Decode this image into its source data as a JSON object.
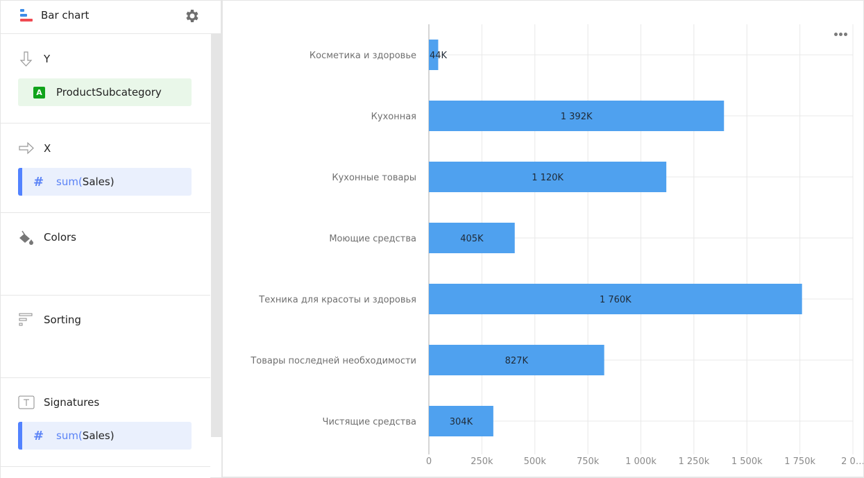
{
  "panel": {
    "title": "Bar chart",
    "icons": {
      "chart_type": "bar-chart-icon",
      "settings": "gear-icon"
    },
    "sections": [
      {
        "id": "y",
        "title": "Y",
        "icon": "arrow-down-icon",
        "fields": [
          {
            "type": "dimension",
            "type_badge": "A",
            "name": "ProductSubcategory",
            "color": "#10a31b"
          }
        ]
      },
      {
        "id": "x",
        "title": "X",
        "icon": "arrow-right-icon",
        "fields": [
          {
            "type": "measure",
            "fn": "sum(",
            "name": "Sales)",
            "color": "#5282ff"
          }
        ]
      },
      {
        "id": "colors",
        "title": "Colors",
        "icon": "paint-bucket-icon",
        "fields": []
      },
      {
        "id": "sorting",
        "title": "Sorting",
        "icon": "sorting-icon",
        "fields": []
      },
      {
        "id": "signatures",
        "title": "Signatures",
        "icon": "text-icon",
        "fields": [
          {
            "type": "measure",
            "fn": "sum(",
            "name": "Sales)",
            "color": "#5282ff"
          }
        ]
      }
    ]
  },
  "chart": {
    "more_menu_icon": "ellipsis-icon"
  },
  "chart_data": {
    "type": "bar",
    "orientation": "horizontal",
    "title": "",
    "xlabel": "",
    "ylabel": "",
    "categories": [
      "Косметика и здоровье",
      "Кухонная",
      "Кухонные товары",
      "Моющие средства",
      "Техника для красоты и здоровья",
      "Товары последней необходимости",
      "Чистящие средства"
    ],
    "values": [
      44000,
      1392000,
      1120000,
      405000,
      1760000,
      827000,
      304000
    ],
    "data_labels": [
      "44K",
      "1 392K",
      "1 120K",
      "405K",
      "1 760K",
      "827K",
      "304K"
    ],
    "xlim": [
      0,
      2000000
    ],
    "x_ticks": [
      0,
      250000,
      500000,
      750000,
      1000000,
      1250000,
      1500000,
      1750000,
      2000000
    ],
    "x_tick_labels": [
      "0",
      "250k",
      "500k",
      "750k",
      "1 000k",
      "1 250k",
      "1 500k",
      "1 750k",
      "2 0…"
    ],
    "bar_color": "#4fa1ef",
    "grid": true,
    "legend": "none"
  }
}
